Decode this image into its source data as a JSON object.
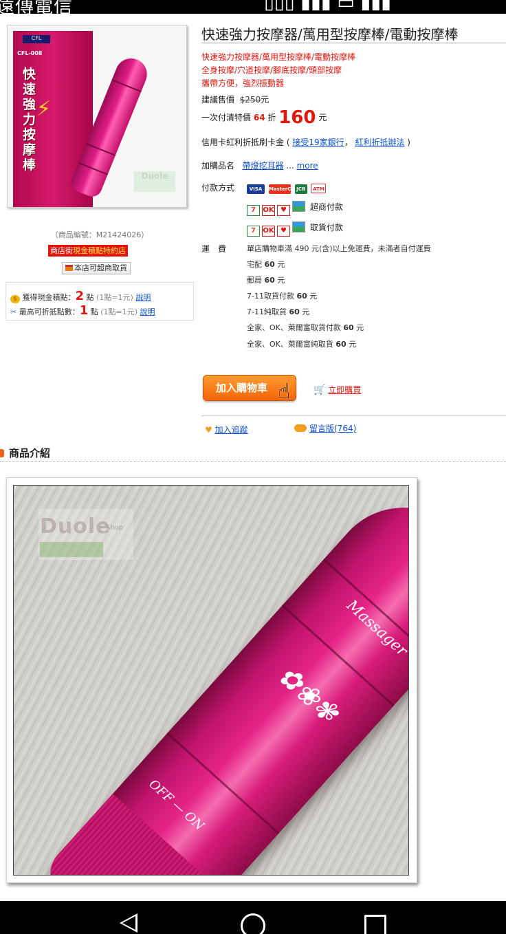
{
  "status_bar": {
    "carrier": "遠傳電信",
    "right_text": "[time/signal]"
  },
  "product": {
    "title": "快速強力按摩器/萬用型按摩棒/電動按摩棒",
    "desc_lines": [
      "快速強力按摩器/萬用型按摩棒/電動按摩棒",
      "全身按摩/穴道按摩/腳底按摩/頭部按摩",
      "攜帶方便，強烈振動器"
    ],
    "id_text": "（商品編號：M21424026）",
    "thumb": {
      "brand": "CFL",
      "model": "CFL-008",
      "vertical_text": "快速強力按摩棒",
      "watermark": "Duole"
    }
  },
  "badges": {
    "store_prefix": "商店街",
    "store_highlight": "現金積點特約店",
    "pickup": "本店可超商取貨"
  },
  "points": {
    "earn_label": "獲得現金積點：",
    "earn_value": "2",
    "earn_unit": "點",
    "earn_note": "(1點=1元)",
    "max_label": "最高可折抵點數：",
    "max_value": "1",
    "max_unit": "點",
    "max_note": "(1點=1元)",
    "explain_link": "說明"
  },
  "pricing": {
    "msrp_label": "建議售價",
    "msrp_value": "$250",
    "msrp_unit": "元",
    "sale_label": "一次付清特價",
    "discount": "64",
    "discount_unit": "折",
    "sale_price": "160",
    "sale_unit": "元"
  },
  "credit": {
    "prefix": "信用卡紅利折抵刷卡金 (",
    "banks_link": "接受19家銀行",
    "comma": "，",
    "bonus_link": "紅利折抵辦法",
    "suffix": ")"
  },
  "addon": {
    "label": "加購品名",
    "item_link": "帶燈挖耳器",
    "more": "more"
  },
  "payment": {
    "label": "付款方式",
    "cards": [
      "VISA",
      "MasterCard",
      "JCB",
      "ATM"
    ],
    "cvs": [
      "7-11",
      "OK",
      "萊爾富",
      "全家"
    ],
    "cvs_pay_text": "超商付款",
    "cvs_pickup_text": "取貨付款"
  },
  "shipping": {
    "label": "運　費",
    "free_note": "單店購物車滿 490 元(含)以上免運費，未滿者自付運費",
    "items": [
      {
        "name": "宅配",
        "price": "60",
        "unit": "元"
      },
      {
        "name": "郵局",
        "price": "60",
        "unit": "元"
      },
      {
        "name": "7-11取貨付款",
        "price": "60",
        "unit": "元"
      },
      {
        "name": "7-11純取貨",
        "price": "60",
        "unit": "元"
      },
      {
        "name": "全家、OK、萊爾富取貨付款",
        "price": "60",
        "unit": "元"
      },
      {
        "name": "全家、OK、萊爾富純取貨",
        "price": "60",
        "unit": "元"
      }
    ]
  },
  "actions": {
    "add_to_cart": "加入購物車",
    "buy_now": "立即購買",
    "follow": "加入追蹤",
    "board": "留言版(764)"
  },
  "section": {
    "intro_title": "商品介紹"
  },
  "photo": {
    "watermark_main": "Duole",
    "watermark_sub": "Shop",
    "massager_label": "Massager",
    "switch_text": "OFF — ON"
  },
  "colors": {
    "accent_red": "#e3150c",
    "link_blue": "#0a4fd8",
    "cart_orange": "#f56507",
    "product_pink": "#e52587"
  }
}
